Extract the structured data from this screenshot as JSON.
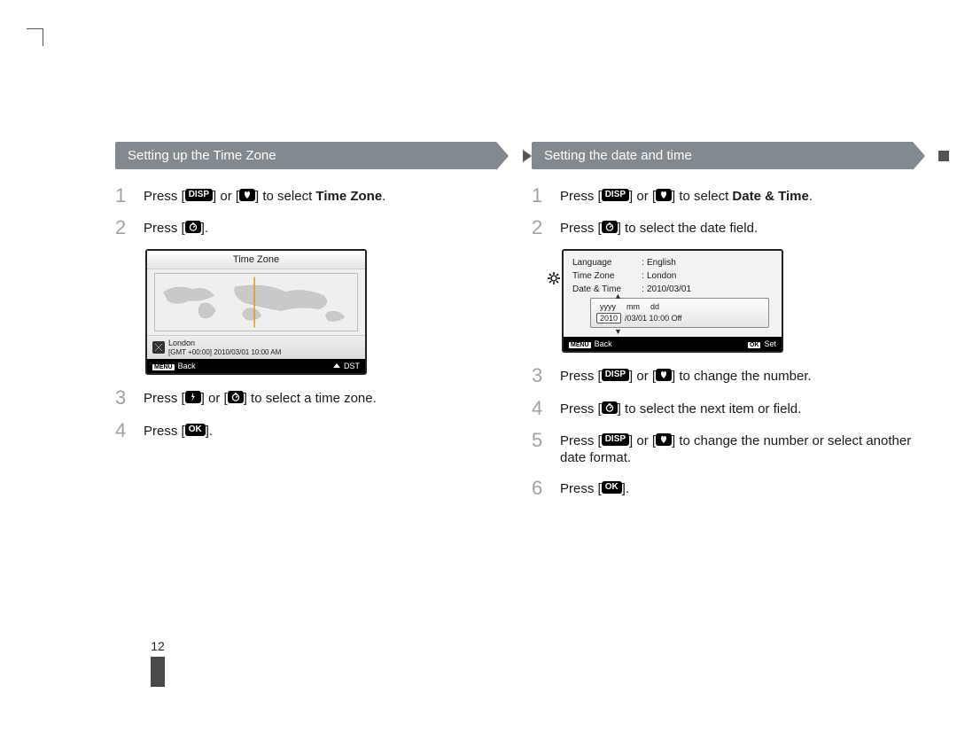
{
  "page_number": "12",
  "left": {
    "header": "Setting up the Time Zone",
    "steps": {
      "n1": "1",
      "s1_a": "Press [",
      "s1_b": "] or [",
      "s1_c": "] to select ",
      "s1_bold": "Time Zone",
      "s1_d": ".",
      "n2": "2",
      "s2_a": "Press [",
      "s2_b": "].",
      "n3": "3",
      "s3_a": "Press [",
      "s3_b": "] or [",
      "s3_c": "] to select a time zone.",
      "n4": "4",
      "s4_a": "Press [",
      "s4_b": "]."
    },
    "screen": {
      "title": "Time Zone",
      "city": "London",
      "gmt": "[GMT +00:00] 2010/03/01 10:00 AM",
      "back_label": "Back",
      "dst_label": "DST",
      "menu_pill": "MENU"
    }
  },
  "right": {
    "header": "Setting the date and time",
    "steps": {
      "n1": "1",
      "s1_a": "Press [",
      "s1_b": "] or [",
      "s1_c": "] to select ",
      "s1_bold": "Date & Time",
      "s1_d": ".",
      "n2": "2",
      "s2_a": "Press [",
      "s2_b": "] to select the date field.",
      "n3": "3",
      "s3_a": "Press [",
      "s3_b": "] or [",
      "s3_c": "] to change the number.",
      "n4": "4",
      "s4_a": "Press [",
      "s4_b": "] to select the next item or field.",
      "n5": "5",
      "s5_a": "Press [",
      "s5_b": "] or [",
      "s5_c": "] to change the number or select another date format.",
      "n6": "6",
      "s6_a": "Press [",
      "s6_b": "]."
    },
    "screen": {
      "rows": {
        "r1k": "Language",
        "r1v": "English",
        "r2k": "Time Zone",
        "r2v": "London",
        "r3k": "Date & Time",
        "r3v": "2010/03/01"
      },
      "date_labels": {
        "y": "yyyy",
        "m": "mm",
        "d": "dd"
      },
      "date_values": {
        "y": "2010",
        "rest": "/03/01   10:00   Off"
      },
      "back_label": "Back",
      "set_label": "Set",
      "menu_pill": "MENU",
      "ok_pill": "OK"
    }
  },
  "icons": {
    "disp": "DISP",
    "ok": "OK"
  }
}
